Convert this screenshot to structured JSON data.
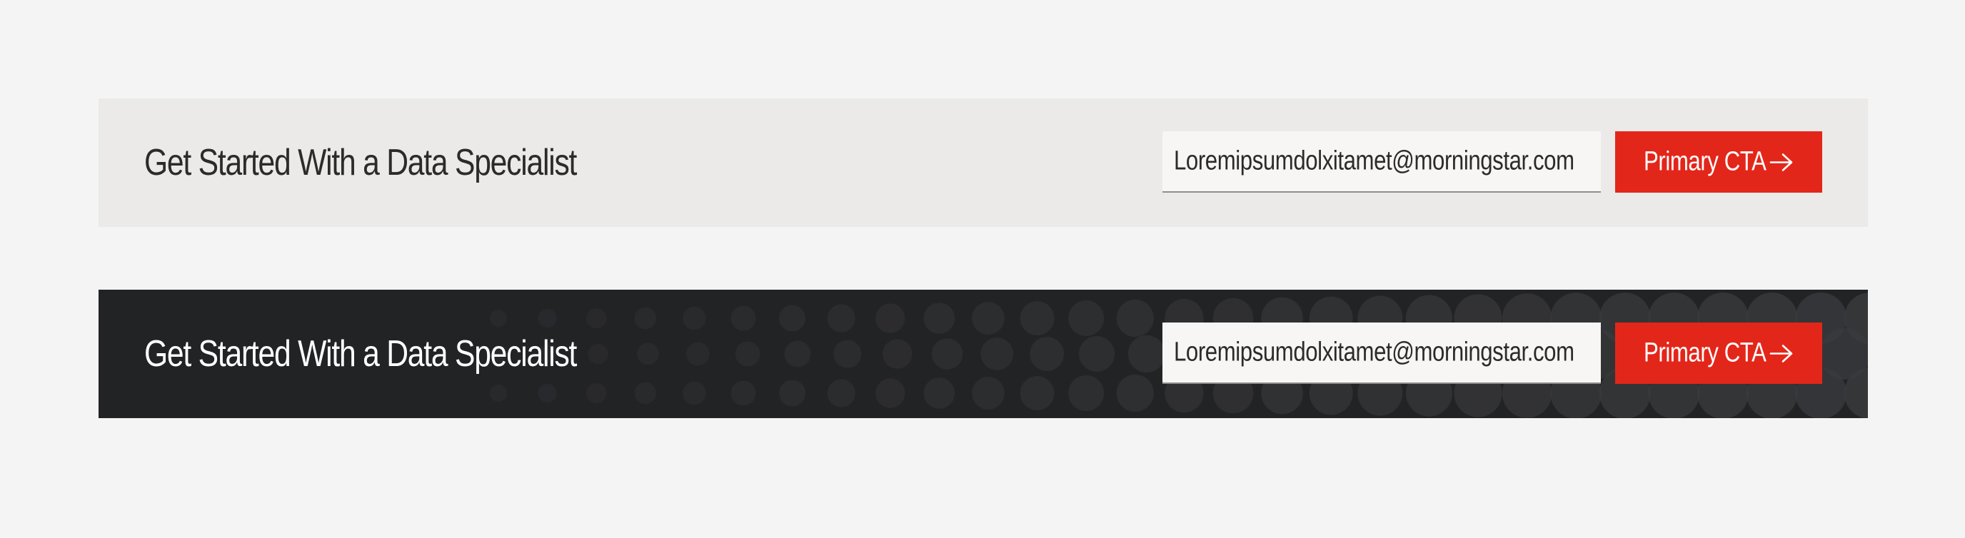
{
  "banners": [
    {
      "theme": "light",
      "headline": "Get Started With a Data Specialist",
      "email_value": "Loremipsumdolxitamet@morningstar.com",
      "cta_label": "Primary CTA",
      "cta_icon": "arrow-right-icon"
    },
    {
      "theme": "dark",
      "headline": "Get Started With a Data Specialist",
      "email_value": "Loremipsumdolxitamet@morningstar.com",
      "cta_label": "Primary CTA",
      "cta_icon": "arrow-right-icon"
    }
  ],
  "colors": {
    "page_background": "#f4f4f4",
    "light_banner": "#ebeae8",
    "dark_banner": "#222325",
    "cta": "#e3261a",
    "dot_pattern": "#3a3b3d"
  }
}
